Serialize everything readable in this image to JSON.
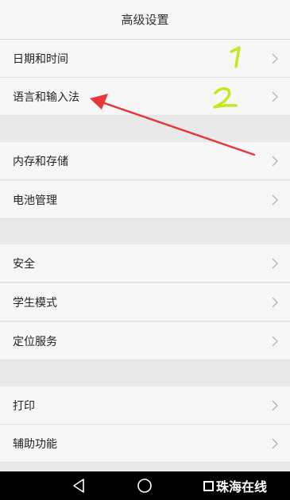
{
  "header": {
    "title": "高级设置"
  },
  "items": [
    {
      "label": "日期和时间"
    },
    {
      "label": "语言和输入法"
    },
    {
      "label": "内存和存储"
    },
    {
      "label": "电池管理"
    },
    {
      "label": "安全"
    },
    {
      "label": "学生模式"
    },
    {
      "label": "定位服务"
    },
    {
      "label": "打印"
    },
    {
      "label": "辅助功能"
    }
  ],
  "annotations": {
    "mark_1": "1",
    "mark_2": "2",
    "color": "#c8e61a",
    "arrow_color": "#e8363a"
  },
  "icons": [
    "chevron-right-icon",
    "back-icon",
    "home-icon"
  ],
  "watermark": {
    "text": "珠海在线"
  }
}
